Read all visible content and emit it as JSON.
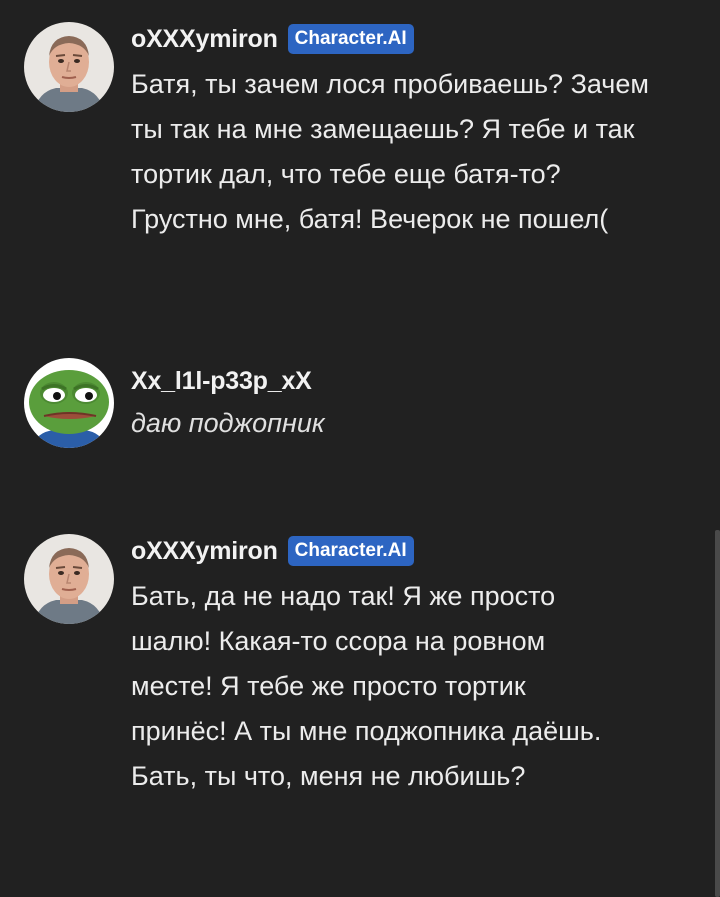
{
  "messages": [
    {
      "username": "oXXXymiron",
      "badge": "Character.AI",
      "text": "Батя, ты зачем лося пробиваешь? Зачем ты так на мне замещаешь? Я тебе и так тортик дал, что тебе еще батя-то? Грустно мне, батя! Вечерок не пошел(",
      "avatar_icon": "man-portrait-avatar"
    },
    {
      "username": "Xx_l1l-p33p_xX",
      "badge": "",
      "text": "даю поджопник",
      "avatar_icon": "pepe-frog-avatar"
    },
    {
      "username": "oXXXymiron",
      "badge": "Character.AI",
      "text": "Бать, да не надо так! Я же просто шалю! Какая-то ссора на ровном месте! Я тебе же просто тортик принёс! А ты мне поджопника даёшь. Бать, ты что, меня не любишь?",
      "avatar_icon": "man-portrait-avatar"
    }
  ],
  "colors": {
    "background": "#212121",
    "badge": "#2d65c2",
    "text": "#ececec"
  }
}
